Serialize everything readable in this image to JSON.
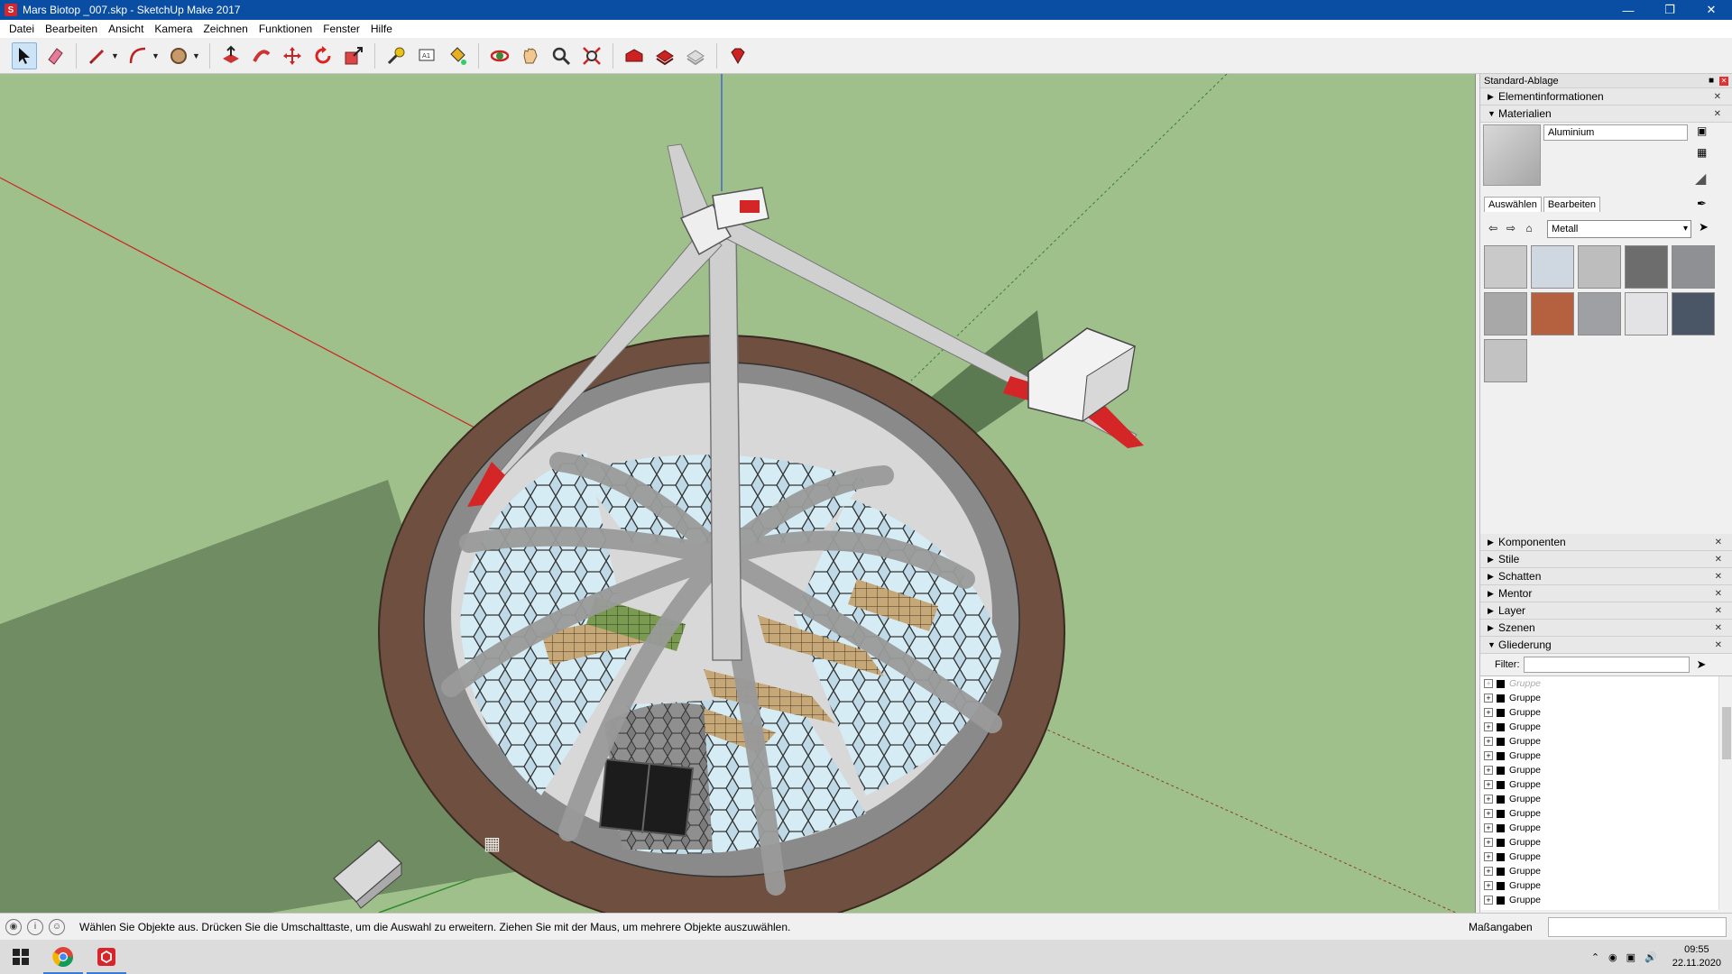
{
  "window": {
    "title": "Mars Biotop _007.skp - SketchUp Make 2017",
    "app_icon": "sketchup-icon",
    "controls": [
      "minimize-icon",
      "restore-icon",
      "close-icon"
    ]
  },
  "menu": [
    "Datei",
    "Bearbeiten",
    "Ansicht",
    "Kamera",
    "Zeichnen",
    "Funktionen",
    "Fenster",
    "Hilfe"
  ],
  "toolbar": {
    "tools": [
      "select-icon",
      "eraser-icon",
      "pencil-line-icon",
      "arc-icon",
      "circle-icon",
      "push-pull-icon",
      "follow-me-icon",
      "move-icon",
      "rotate-icon",
      "scale-icon",
      "tape-measure-icon",
      "text-icon",
      "paint-bucket-icon",
      "orbit-icon",
      "pan-icon",
      "zoom-icon",
      "zoom-extents-icon",
      "warehouse-icon",
      "extension-warehouse-icon",
      "layout-icon",
      "ruby-icon"
    ]
  },
  "tray": {
    "title": "Standard-Ablage",
    "panels_top": [
      {
        "label": "Elementinformationen",
        "expanded": false
      },
      {
        "label": "Materialien",
        "expanded": true
      }
    ],
    "materials": {
      "name": "Aluminium",
      "tab_select": "Auswählen",
      "tab_edit": "Bearbeiten",
      "library": "Metall",
      "swatch_colors": [
        "#c9c9c9",
        "#cfd8e0",
        "#bdbdbd",
        "#6d6d6d",
        "#8e9094",
        "#a8a8a8",
        "#b5603f",
        "#9ea0a3",
        "#e3e3e5",
        "#4a5565",
        "#c2c2c2"
      ]
    },
    "panels_bottom": [
      {
        "label": "Komponenten",
        "expanded": false
      },
      {
        "label": "Stile",
        "expanded": false
      },
      {
        "label": "Schatten",
        "expanded": false
      },
      {
        "label": "Mentor",
        "expanded": false
      },
      {
        "label": "Layer",
        "expanded": false
      },
      {
        "label": "Szenen",
        "expanded": false
      },
      {
        "label": "Gliederung",
        "expanded": true
      }
    ],
    "outliner": {
      "filter_label": "Filter:",
      "rows": [
        "Gruppe",
        "Gruppe",
        "Gruppe",
        "Gruppe",
        "Gruppe",
        "Gruppe",
        "Gruppe",
        "Gruppe",
        "Gruppe",
        "Gruppe",
        "Gruppe",
        "Gruppe",
        "Gruppe",
        "Gruppe",
        "Gruppe",
        "Gruppe"
      ]
    }
  },
  "status": {
    "message": "Wählen Sie Objekte aus. Drücken Sie die Umschalttaste, um die Auswahl zu erweitern. Ziehen Sie mit der Maus, um mehrere Objekte auszuwählen.",
    "measurements_label": "Maßangaben"
  },
  "taskbar": {
    "time": "09:55",
    "date": "22.11.2020",
    "apps": [
      "chrome-icon",
      "sketchup-icon"
    ]
  },
  "colors": {
    "titlebar": "#0a4ea4",
    "ground": "#9fc08b",
    "accent_red": "#d6262c"
  }
}
